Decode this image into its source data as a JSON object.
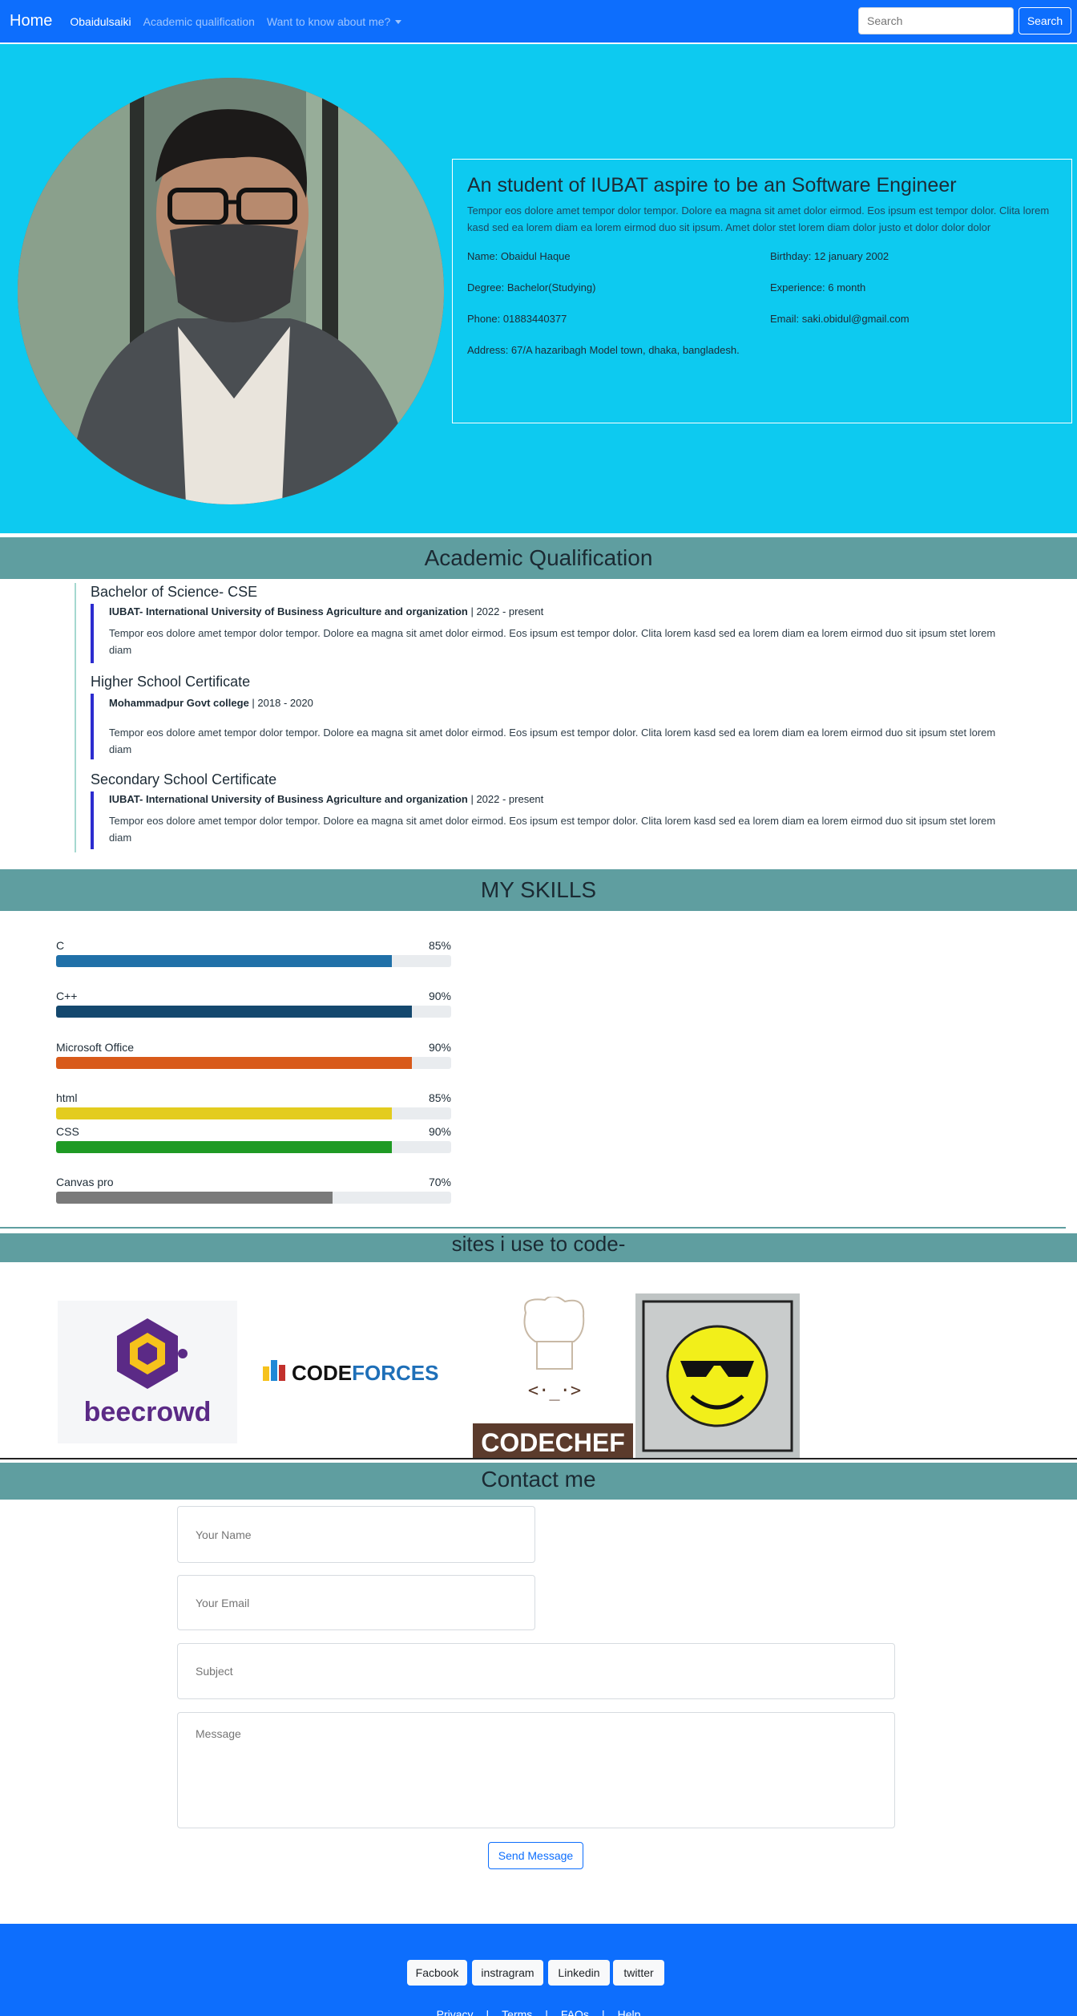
{
  "nav": {
    "brand": "Home",
    "links": [
      "Obaidulsaiki",
      "Academic qualification",
      "Want to know about me?"
    ],
    "search_placeholder": "Search",
    "search_button": "Search"
  },
  "hero": {
    "title": "An student of IUBAT aspire to be an Software Engineer",
    "description": "Tempor eos dolore amet tempor dolor tempor. Dolore ea magna sit amet dolor eirmod. Eos ipsum est tempor dolor. Clita lorem kasd sed ea lorem diam ea lorem eirmod duo sit ipsum. Amet dolor stet lorem diam dolor justo et dolor dolor dolor",
    "name": "Name: Obaidul Haque",
    "birthday": "Birthday: 12 january 2002",
    "degree": "Degree: Bachelor(Studying)",
    "experience": "Experience: 6 month",
    "phone": "Phone: 01883440377",
    "email": "Email: saki.obidul@gmail.com",
    "address": "Address: 67/A hazaribagh Model town, dhaka, bangladesh."
  },
  "academic": {
    "heading": "Academic Qualification",
    "items": [
      {
        "title": "Bachelor of Science- CSE",
        "institution": "IUBAT- International University of Business Agriculture and organization",
        "years": " | 2022 - present",
        "text": "Tempor eos dolore amet tempor dolor tempor. Dolore ea magna sit amet dolor eirmod. Eos ipsum est tempor dolor. Clita lorem kasd sed ea lorem diam ea lorem eirmod duo sit ipsum stet lorem diam"
      },
      {
        "title": "Higher School Certificate",
        "institution": "Mohammadpur Govt college",
        "years": " | 2018 - 2020",
        "text": "Tempor eos dolore amet tempor dolor tempor. Dolore ea magna sit amet dolor eirmod. Eos ipsum est tempor dolor. Clita lorem kasd sed ea lorem diam ea lorem eirmod duo sit ipsum stet lorem diam"
      },
      {
        "title": "Secondary School Certificate",
        "institution": "IUBAT- International University of Business Agriculture and organization",
        "years": " | 2022 - present",
        "text": "Tempor eos dolore amet tempor dolor tempor. Dolore ea magna sit amet dolor eirmod. Eos ipsum est tempor dolor. Clita lorem kasd sed ea lorem diam ea lorem eirmod duo sit ipsum stet lorem diam"
      }
    ]
  },
  "skills": {
    "heading": "MY SKILLS",
    "items": [
      {
        "name": "C",
        "percent_label": "85%",
        "fill": 0.85,
        "color": "#2070a8"
      },
      {
        "name": "C++",
        "percent_label": "90%",
        "fill": 0.9,
        "color": "#14486e"
      },
      {
        "name": "Microsoft Office",
        "percent_label": "90%",
        "fill": 0.9,
        "color": "#d85a1a"
      },
      {
        "name": "html",
        "percent_label": "85%",
        "fill": 0.85,
        "color": "#e3cc1e"
      },
      {
        "name": "CSS",
        "percent_label": "90%",
        "fill": 0.85,
        "color": "#1f9a24"
      },
      {
        "name": "Canvas pro",
        "percent_label": "70%",
        "fill": 0.7,
        "color": "#7a7a7a"
      }
    ]
  },
  "sites": {
    "heading": "sites i use to code-",
    "beecrowd": "beecrowd",
    "codeforces_a": "CODE",
    "codeforces_b": "FORCES",
    "codechef": "CODECHEF"
  },
  "contact": {
    "heading": "Contact me",
    "name_placeholder": "Your Name",
    "email_placeholder": "Your Email",
    "subject_placeholder": "Subject",
    "message_placeholder": "Message",
    "send": "Send Message"
  },
  "footer": {
    "social": [
      "Facbook",
      "instragram",
      "Linkedin",
      "twitter"
    ],
    "links": [
      "Privacy",
      "Terms",
      "FAQs",
      "Help"
    ],
    "separator": "|"
  }
}
